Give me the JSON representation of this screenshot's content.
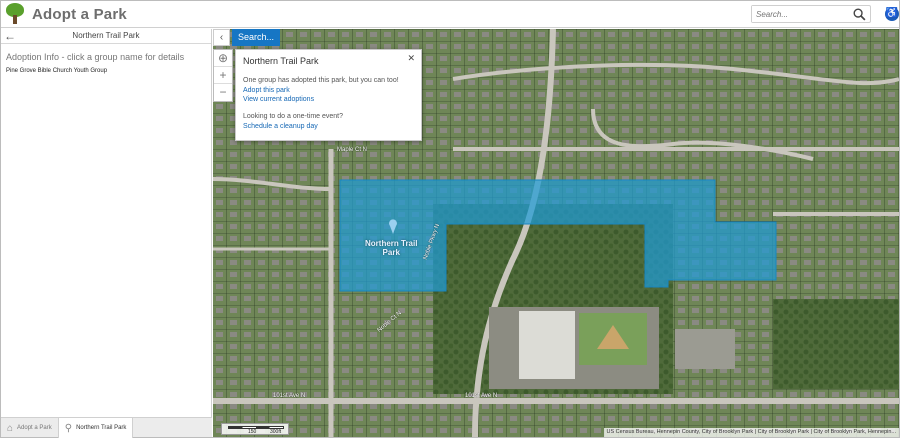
{
  "header": {
    "app_title": "Adopt a Park",
    "search_placeholder": "Search..."
  },
  "panel": {
    "title": "Northern Trail Park",
    "adoption_info": "Adoption Info - click a group name for details",
    "groups": [
      "Pine Grove Bible Church Youth Group"
    ],
    "tabs": [
      {
        "label": "Adopt a Park",
        "icon": "home-icon"
      },
      {
        "label": "Northern Trail Park",
        "icon": "search-icon"
      }
    ]
  },
  "map": {
    "search_button": "Search...",
    "popup": {
      "title": "Northern Trail Park",
      "message": "One group has adopted this park, but you can too!",
      "adopt_link": "Adopt this park",
      "view_link": "View current adoptions",
      "event_question": "Looking to do a one-time event?",
      "cleanup_link": "Schedule a cleanup day"
    },
    "park_label_line1": "Northern Trail",
    "park_label_line2": "Park",
    "scale_labels": [
      "150",
      "300ft"
    ],
    "attribution": "US Census Bureau, Hennepin County, City of Brooklyn Park | City of Brooklyn Park | City of Brooklyn Park, Hennepin...",
    "streets": [
      "Noble Pkwy N",
      "101st Ave N",
      "101st Ave N",
      "Noble Ct N",
      "Maple Ct N"
    ]
  },
  "colors": {
    "accent": "#1676c4",
    "park_fill": "#1e9bd6",
    "brand_green": "#5aa02c"
  }
}
